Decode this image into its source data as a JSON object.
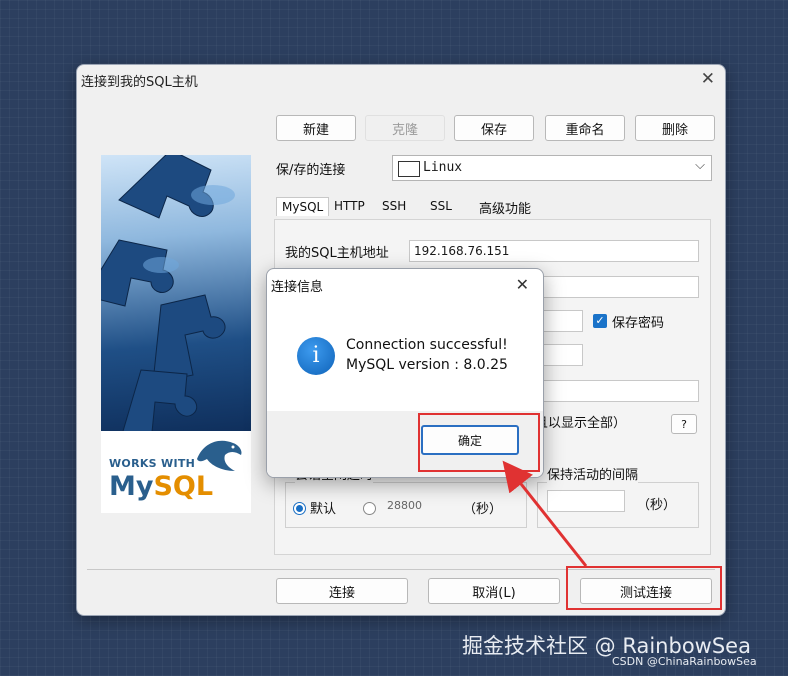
{
  "window": {
    "title": "连接到我的SQL主机",
    "close_glyph": "✕"
  },
  "toolbar": {
    "new": "新建",
    "clone": "克隆",
    "save": "保存",
    "rename": "重命名",
    "delete": "删除"
  },
  "saved_connections": {
    "label": "保/存的连接",
    "selected": "Linux"
  },
  "tabs": [
    {
      "label": "MySQL",
      "active": true
    },
    {
      "label": "HTTP",
      "active": false
    },
    {
      "label": "SSH",
      "active": false
    },
    {
      "label": "SSL",
      "active": false
    },
    {
      "label": "高级功能",
      "active": false
    }
  ],
  "mysql_tab": {
    "host_label": "我的SQL主机地址",
    "host_value": "192.168.76.151",
    "save_password_label": "保存密码",
    "save_password_checked": true,
    "show_all_text": "且以显示全部）",
    "help_button": "?",
    "session_idle_label": "会话空闲超时",
    "default_label": "默认",
    "default_selected": true,
    "timeout_value": "28800",
    "seconds_1": "（秒）",
    "keepalive_label": "保持活动的间隔",
    "seconds_2": "（秒）"
  },
  "side_logo": {
    "works_with": "WORKS WITH",
    "my": "My",
    "sql": "SQL"
  },
  "footer": {
    "connect": "连接",
    "cancel": "取消(L)",
    "test": "测试连接"
  },
  "dialog": {
    "title": "连接信息",
    "close_glyph": "✕",
    "icon_glyph": "i",
    "line1": "Connection successful!",
    "line2": "MySQL version : 8.0.25",
    "ok": "确定"
  },
  "colors": {
    "desktop": "#2c3f5f",
    "annotation_red": "#e03232",
    "accent_blue": "#1a73c9"
  },
  "watermark": {
    "main": "掘金技术社区 @ RainbowSea",
    "sub": "CSDN @ChinaRainbowSea"
  }
}
